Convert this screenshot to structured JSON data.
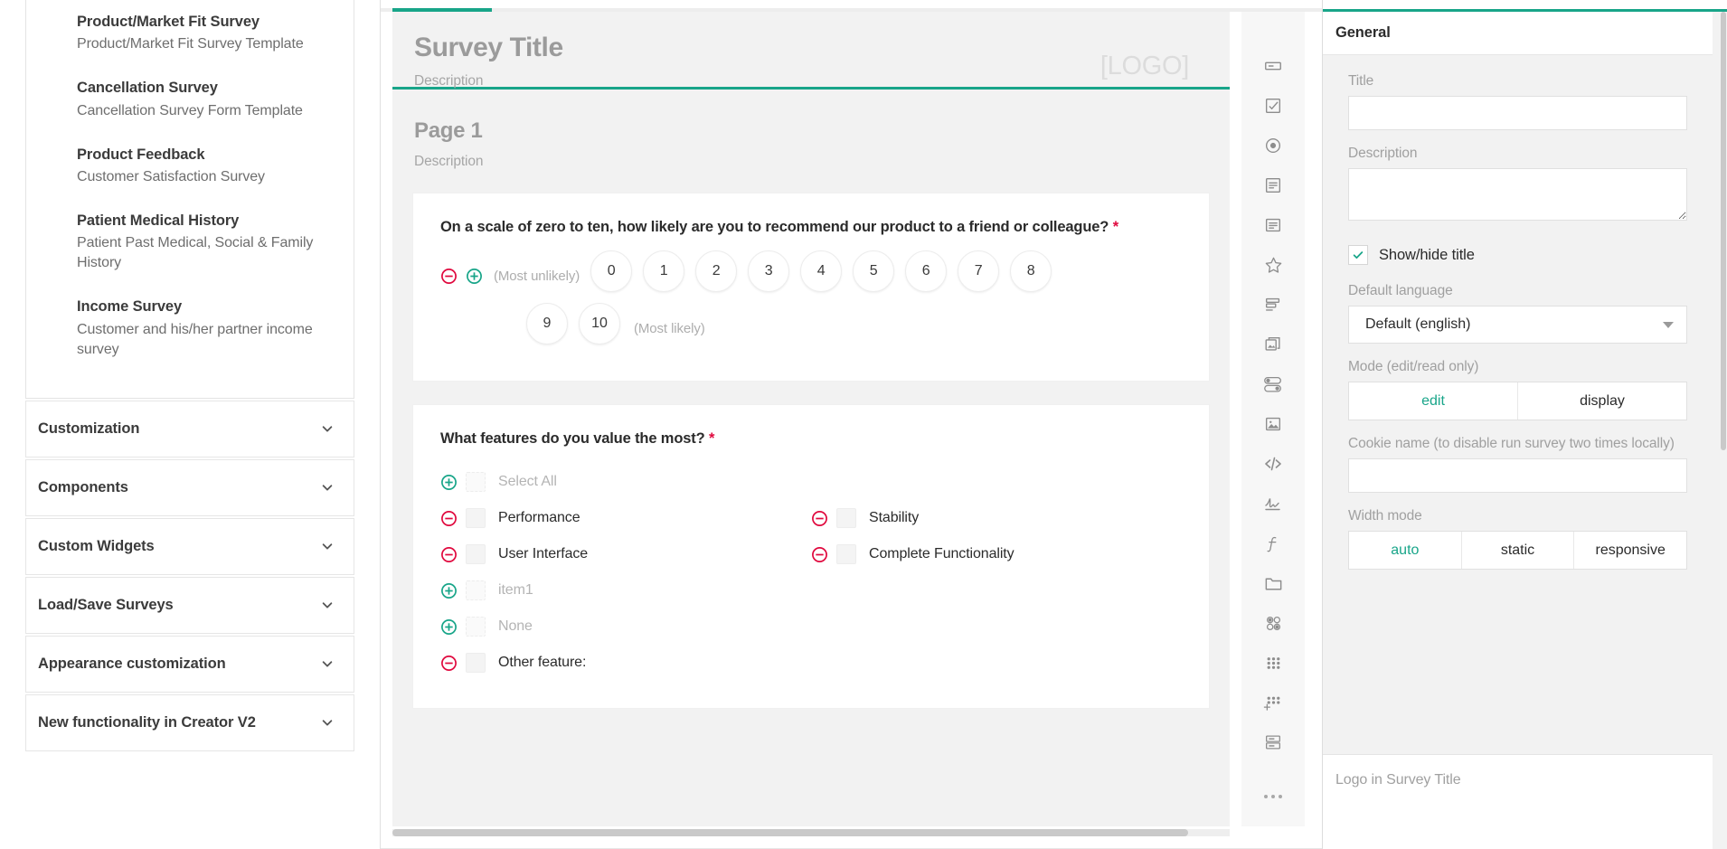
{
  "sidebar": {
    "templates": [
      {
        "title": "Product/Market Fit Survey",
        "subtitle": "Product/Market Fit Survey Template"
      },
      {
        "title": "Cancellation Survey",
        "subtitle": "Cancellation Survey Form Template"
      },
      {
        "title": "Product Feedback",
        "subtitle": "Customer Satisfaction Survey"
      },
      {
        "title": "Patient Medical History",
        "subtitle": "Patient Past Medical, Social & Family History"
      },
      {
        "title": "Income Survey",
        "subtitle": "Customer and his/her partner income survey"
      }
    ],
    "accordions": [
      {
        "label": "Customization"
      },
      {
        "label": "Components"
      },
      {
        "label": "Custom Widgets"
      },
      {
        "label": "Load/Save Surveys"
      },
      {
        "label": "Appearance customization"
      },
      {
        "label": "New functionality in Creator V2"
      }
    ]
  },
  "designer": {
    "survey": {
      "title": "Survey Title",
      "description": "Description",
      "logo_placeholder": "[LOGO]"
    },
    "page": {
      "title": "Page 1",
      "description": "Description"
    },
    "questions": [
      {
        "title": "On a scale of zero to ten, how likely are you to recommend our product to a friend or colleague?",
        "required_marker": "*",
        "min_label": "(Most unlikely)",
        "max_label": "(Most likely)",
        "rate_values_row1": [
          "0",
          "1",
          "2",
          "3",
          "4",
          "5",
          "6",
          "7",
          "8"
        ],
        "rate_values_row2": [
          "9",
          "10"
        ]
      },
      {
        "title": "What features do you value the most?",
        "required_marker": "*",
        "select_all_label": "Select All",
        "choices": [
          {
            "left": "Performance",
            "right": "Stability"
          },
          {
            "left": "User Interface",
            "right": "Complete Functionality"
          }
        ],
        "ghost_choices": [
          "item1",
          "None"
        ],
        "partial_choice": "Other feature:"
      }
    ]
  },
  "toolbar": {
    "icons": [
      "text-field-icon",
      "checkbox-icon",
      "radiogroup-icon",
      "dropdown-icon",
      "comment-icon",
      "rating-icon",
      "ranking-icon",
      "image-picker-icon",
      "boolean-toggle-icon",
      "image-icon",
      "html-code-icon",
      "signature-pad-icon",
      "expression-icon",
      "panel-icon",
      "matrix-single-icon",
      "matrix-multiple-icon",
      "matrix-dynamic-icon",
      "multipletext-icon",
      "more-options-icon"
    ]
  },
  "properties": {
    "header": "General",
    "title_label": "Title",
    "title_value": "",
    "description_label": "Description",
    "description_value": "",
    "show_hide_title_label": "Show/hide title",
    "show_hide_title_checked": true,
    "default_language_label": "Default language",
    "default_language_value": "Default (english)",
    "mode_label": "Mode (edit/read only)",
    "mode_options": [
      "edit",
      "display"
    ],
    "mode_selected": "edit",
    "cookie_label": "Cookie name (to disable run survey two times locally)",
    "cookie_value": "",
    "width_mode_label": "Width mode",
    "width_mode_options": [
      "auto",
      "static",
      "responsive"
    ],
    "width_mode_selected": "auto",
    "footer_label": "Logo in Survey Title"
  },
  "colors": {
    "accent": "#18a589",
    "danger": "#e0093e",
    "surface": "#f2f2f2"
  }
}
